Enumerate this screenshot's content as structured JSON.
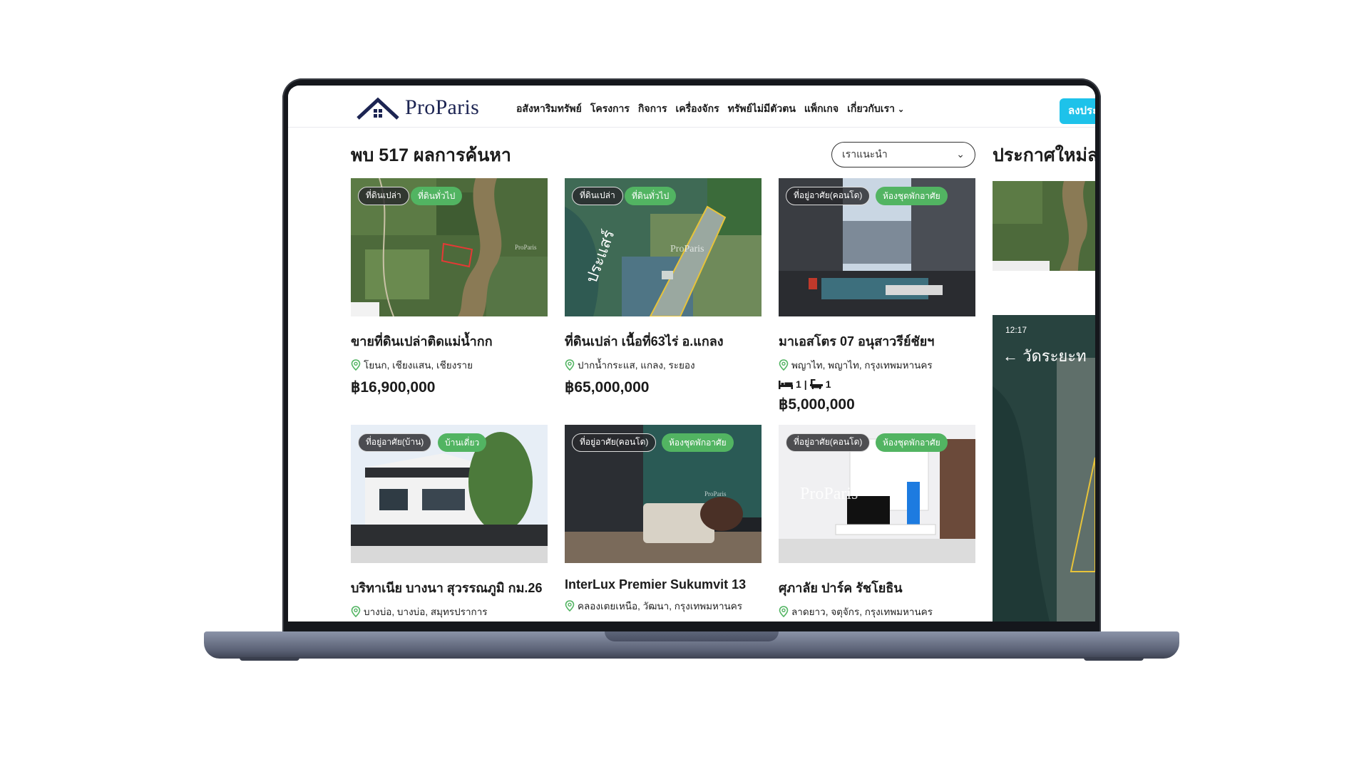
{
  "navbar": {
    "logo_text": "ProParis",
    "menu": [
      "อสังหาริมทรัพย์",
      "โครงการ",
      "กิจการ",
      "เครื่องจักร",
      "ทรัพย์ไม่มีตัวตน",
      "แพ็กเกจ",
      "เกี่ยวกับเรา"
    ],
    "post_button": "ลงประ"
  },
  "results": {
    "title": "พบ 517 ผลการค้นหา",
    "sort_value": "เราแนะนำ"
  },
  "sidebar": {
    "title": "ประกาศใหม่ล่า",
    "time": "12:17",
    "location_label": "วัดระยะท"
  },
  "listings": [
    {
      "tags": [
        "ที่ดินเปล่า",
        "ที่ดินทั่วไป"
      ],
      "title": "ขายที่ดินเปล่าติดแม่น้ำกก",
      "location": "โยนก, เชียงแสน, เชียงราย",
      "price": "฿16,900,000"
    },
    {
      "tags": [
        "ที่ดินเปล่า",
        "ที่ดินทั่วไป"
      ],
      "title": "ที่ดินเปล่า เนื้อที่63ไร่ อ.แกลง",
      "location": "ปากน้ำกระแส, แกลง, ระยอง",
      "price": "฿65,000,000"
    },
    {
      "tags": [
        "ที่อยู่อาศัย(คอนโด)",
        "ห้องชุดพักอาศัย"
      ],
      "title": "มาเอสโตร 07 อนุสาวรีย์ชัยฯ",
      "location": "พญาไท, พญาไท, กรุงเทพมหานคร",
      "beds": "1",
      "baths": "1",
      "price": "฿5,000,000"
    },
    {
      "tags": [
        "ที่อยู่อาศัย(บ้าน)",
        "บ้านเดี่ยว"
      ],
      "title": "บริทาเนีย บางนา สุวรรณภูมิ กม.26",
      "location": "บางบ่อ, บางบ่อ, สมุทรปราการ"
    },
    {
      "tags": [
        "ที่อยู่อาศัย(คอนโด)",
        "ห้องชุดพักอาศัย"
      ],
      "title": "InterLux Premier Sukumvit 13",
      "location": "คลองเตยเหนือ, วัฒนา, กรุงเทพมหานคร"
    },
    {
      "tags": [
        "ที่อยู่อาศัย(คอนโด)",
        "ห้องชุดพักอาศัย"
      ],
      "title": "ศุภาลัย ปาร์ค รัชโยธิน",
      "location": "ลาดยาว, จตุจักร, กรุงเทพมหานคร"
    }
  ],
  "image_overlays": {
    "watermark": "ProParis",
    "map_label": "ประแสร์"
  },
  "colors": {
    "brand_navy": "#1c2452",
    "accent_cyan": "#1ec2ea",
    "tag_green": "#52b462",
    "tag_dark": "#28282c"
  }
}
